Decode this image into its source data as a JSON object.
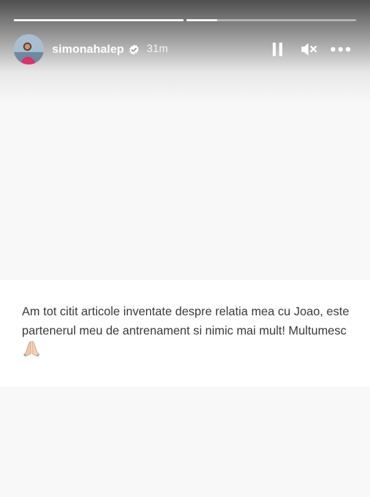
{
  "story": {
    "progress": [
      1.0,
      0.18
    ],
    "username": "simonahalep",
    "verified": true,
    "timestamp": "31m",
    "text": "Am tot citit articole inventate despre relatia mea cu Joao, este partenerul meu de antrenament si nimic mai mult! Multumesc",
    "emoji": "folded-hands-emoji"
  },
  "controls": {
    "pause_icon": "pause-icon",
    "mute_icon": "muted-speaker-icon",
    "more_icon": "more-options-icon"
  },
  "colors": {
    "background": "#f8f8f8",
    "text_band": "#ffffff",
    "text": "#3a3a3a",
    "overlay_text": "#ffffff"
  }
}
